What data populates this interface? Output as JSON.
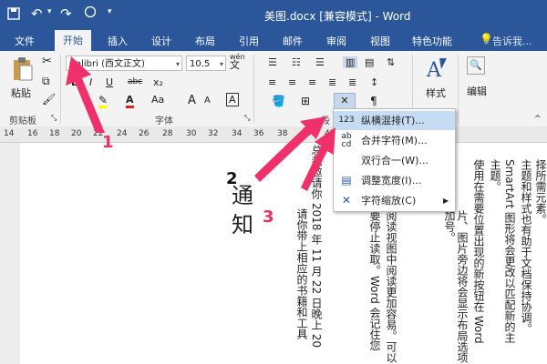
{
  "titlebar": {
    "title": "美图.docx [兼容模式] - Word",
    "save_icon": "save-icon",
    "qat_more": "▾"
  },
  "tabs": [
    {
      "label": "文件"
    },
    {
      "label": "开始"
    },
    {
      "label": "插入"
    },
    {
      "label": "设计"
    },
    {
      "label": "布局"
    },
    {
      "label": "引用"
    },
    {
      "label": "邮件"
    },
    {
      "label": "审阅"
    },
    {
      "label": "视图"
    },
    {
      "label": "特色功能"
    }
  ],
  "tell_me": "告诉我...",
  "ribbon": {
    "paste_label": "粘贴",
    "clipboard_group": "剪贴板",
    "font_group": "字体",
    "paragraph_group": "段",
    "styles_label": "样式",
    "editing_label": "编辑",
    "font_name": "Calibri (西文正文)",
    "font_size": "10.5",
    "bold": "B",
    "italic": "I",
    "underline": "U",
    "strike": "abc",
    "sub": "x₂",
    "font_color_a": "A",
    "change_case": "Aa",
    "grow": "A",
    "shrink": "A",
    "wen": "wén",
    "wen_char": "文"
  },
  "ruler_ticks": [
    "14",
    "16",
    "18",
    "20",
    "22",
    "24",
    "26",
    "28",
    "30",
    "32",
    "34",
    "36",
    "38",
    "40",
    "42"
  ],
  "menu": {
    "items": [
      {
        "icon": "123",
        "label": "纵横混排(T)..."
      },
      {
        "icon": "ab cd",
        "label": "合并字符(M)..."
      },
      {
        "icon": "",
        "label": "双行合一(W)..."
      },
      {
        "icon": "",
        "label": "调整宽度(I)..."
      },
      {
        "icon": "",
        "label": "字符缩放(C)"
      }
    ]
  },
  "document": {
    "big_chars": [
      "通",
      "知"
    ],
    "col1": "总裁邀请你 2018 年 11 月 22 日晚上 20",
    "col2": "请你带上相应的书籍和工具",
    "col3": "要停止读取。Word 会记住您",
    "col4": "阅读视图中阅读更加容易。可以",
    "col5": "加号。",
    "col6": "片、图片旁边将会显示布局选项",
    "col7": "使用在需要位置出现的新按钮在 Word",
    "col8": "主题。",
    "col9": "SmartArt 图形将会更改以匹配新的主",
    "col10": "主题和样式也有助于文档保持协调。",
    "col11": "择所需元素。"
  },
  "annotations": [
    "1",
    "2",
    "3"
  ],
  "colors": {
    "accent": "#2b579a",
    "arrow": "#f0306a",
    "menu_highlight": "#c5dcf2"
  }
}
